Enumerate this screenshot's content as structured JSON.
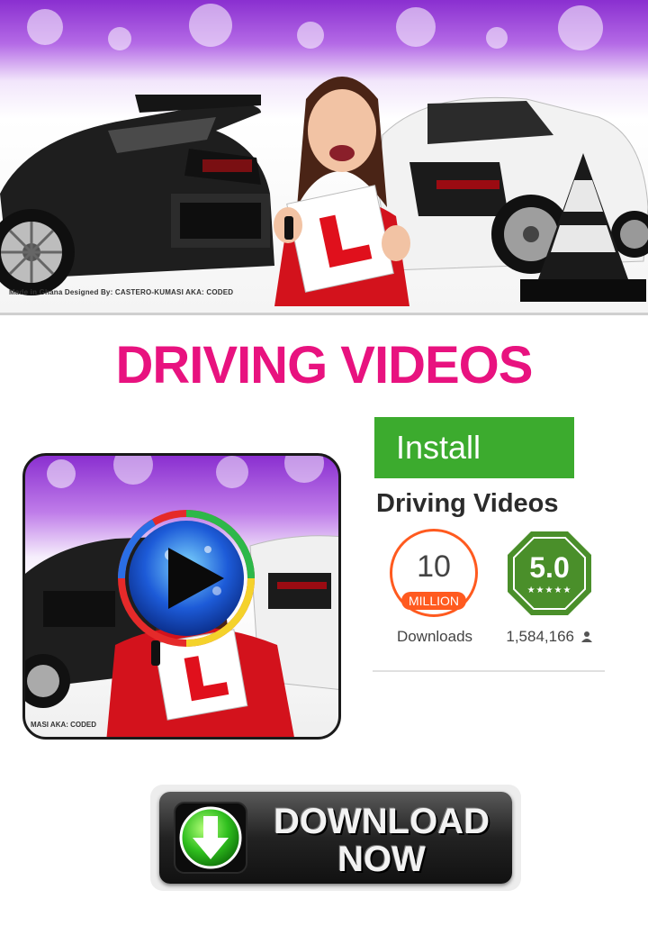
{
  "banner": {
    "credit": "Made in Ghana   Designed By: CASTERO-KUMASI  AKA: CODED"
  },
  "heading": {
    "title": "DRIVING VIDEOS"
  },
  "app_icon": {
    "credit": "MASI  AKA: CODED"
  },
  "store": {
    "install_label": "Install",
    "app_name": "Driving Videos",
    "downloads": {
      "count": "10",
      "unit": "MILLION",
      "label": "Downloads"
    },
    "rating": {
      "value": "5.0",
      "stars": "★★★★★",
      "count": "1,584,166"
    },
    "colors": {
      "install": "#3cab2e",
      "downloads_accent": "#ff5a1f",
      "rating_badge": "#4a8f2a"
    }
  },
  "download_button": {
    "line1": "DOWNLOAD",
    "line2": "NOW"
  },
  "icons": [
    "play-icon",
    "download-arrow-icon",
    "person-icon",
    "steering-key-icon"
  ]
}
